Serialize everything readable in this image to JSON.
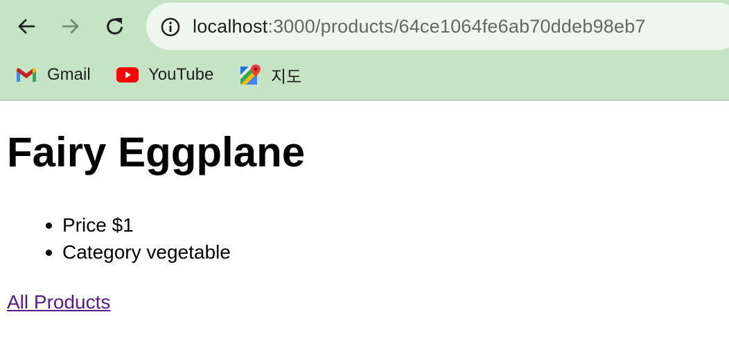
{
  "browser": {
    "url_host": "localhost",
    "url_path": ":3000/products/64ce1064fe6ab70ddeb98eb7",
    "bookmarks": [
      {
        "label": "Gmail",
        "icon": "gmail-icon"
      },
      {
        "label": "YouTube",
        "icon": "youtube-icon"
      },
      {
        "label": "지도",
        "icon": "maps-icon"
      }
    ],
    "colors": {
      "toolbar_bg": "#c5e3c5",
      "address_bg": "#eef7ee"
    }
  },
  "product": {
    "name": "Fairy Eggplane",
    "details": [
      {
        "text": "Price $1"
      },
      {
        "text": "Category vegetable"
      }
    ],
    "back_link_label": "All Products",
    "link_color": "#551a8b"
  }
}
